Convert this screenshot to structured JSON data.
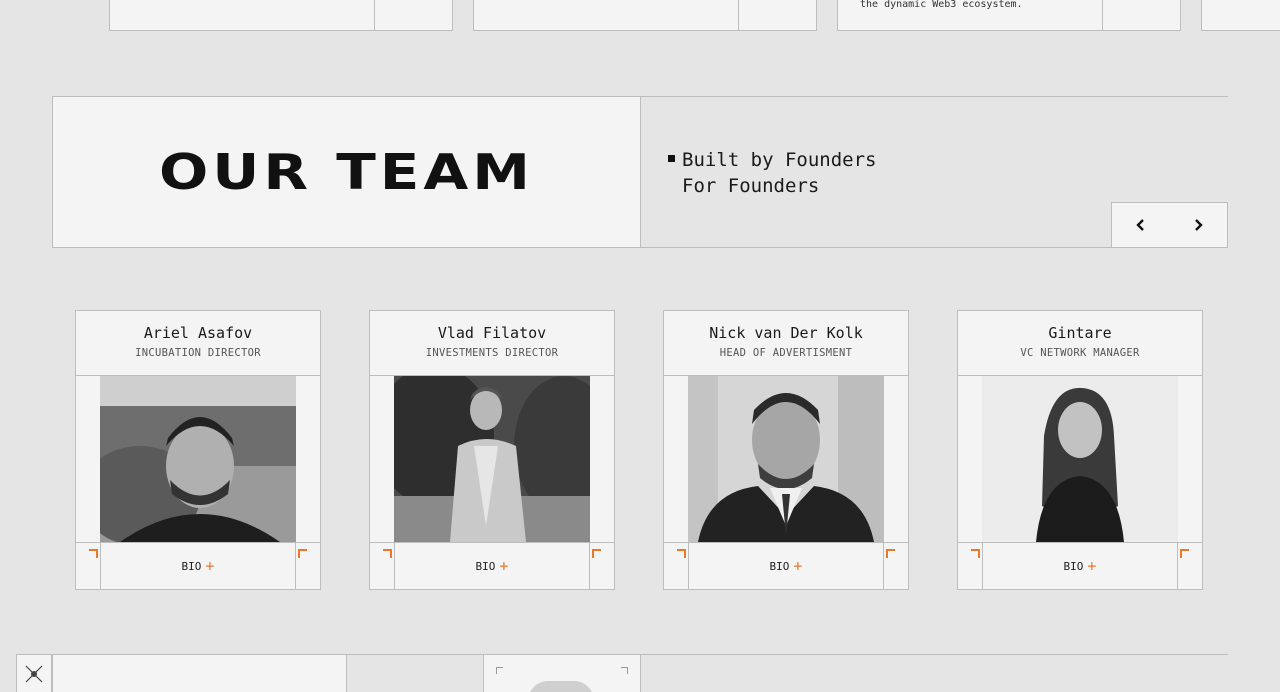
{
  "top_cards": [
    {
      "snippet": ""
    },
    {
      "snippet": ""
    },
    {
      "snippet": "the dynamic Web3 ecosystem."
    }
  ],
  "team": {
    "title": "OUR TEAM",
    "tagline_line1": "Built by Founders",
    "tagline_line2": "For Founders",
    "prev_icon": "chevron-left-icon",
    "next_icon": "chevron-right-icon"
  },
  "members": [
    {
      "name": "Ariel Asafov",
      "role": "INCUBATION DIRECTOR",
      "bio_label": "BIO",
      "plus": "+"
    },
    {
      "name": "Vlad Filatov",
      "role": "INVESTMENTS DIRECTOR",
      "bio_label": "BIO",
      "plus": "+"
    },
    {
      "name": "Nick van Der Kolk",
      "role": "HEAD OF ADVERTISMENT",
      "bio_label": "BIO",
      "plus": "+"
    },
    {
      "name": "Gintare",
      "role": "VC NETWORK MANAGER",
      "bio_label": "BIO",
      "plus": "+"
    }
  ],
  "colors": {
    "accent": "#e8782c",
    "background": "#e5e5e5",
    "panel": "#f4f4f4",
    "border": "#bdbdbd"
  }
}
